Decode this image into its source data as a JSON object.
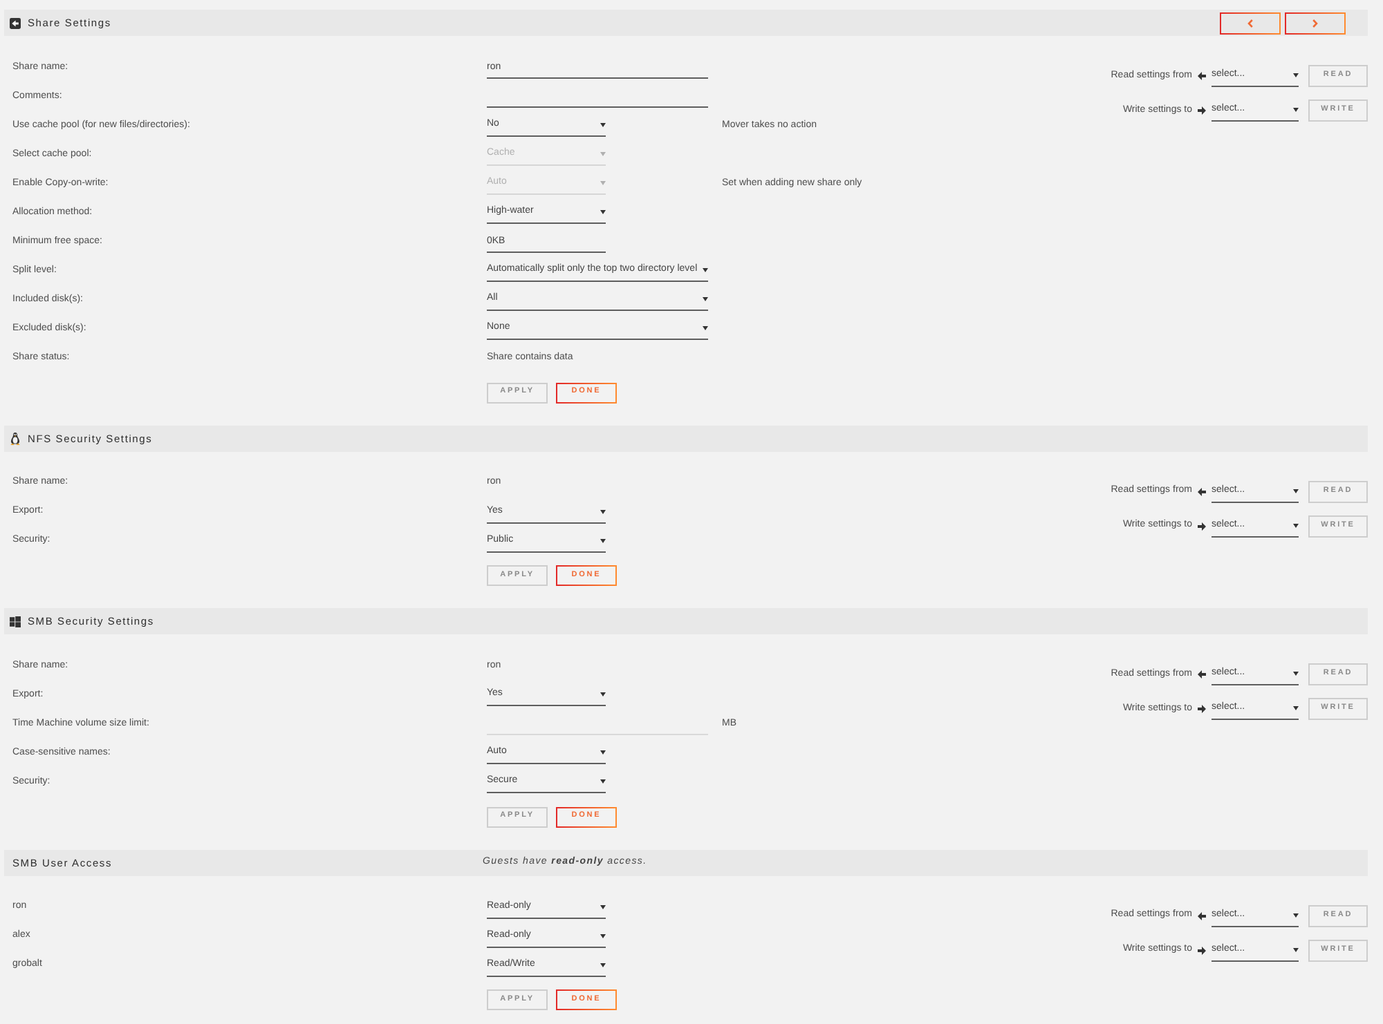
{
  "sections": [
    {
      "kind": "share",
      "title": "Share Settings",
      "nav_buttons": [
        {
          "kind": "previous",
          "disabled": false
        },
        {
          "kind": "next",
          "disabled": false
        }
      ],
      "rows": [
        {
          "label": "Share name:",
          "kind": "field",
          "value": "ron",
          "disabled": false
        },
        {
          "label": "Comments:",
          "kind": "field",
          "disabled": false
        },
        {
          "label": "Use cache pool (for new files/directories):",
          "kind": "select",
          "value": "No",
          "disabled": false,
          "note": "Mover takes no action"
        },
        {
          "label": "Select cache pool:",
          "kind": "select",
          "value": "Cache",
          "disabled": true
        },
        {
          "label": "Enable Copy-on-write:",
          "kind": "select",
          "value": "Auto",
          "disabled": true,
          "note": "Set when adding new share only"
        },
        {
          "label": "Allocation method:",
          "kind": "select",
          "value": "High-water",
          "disabled": false
        },
        {
          "label": "Minimum free space:",
          "kind": "short_field",
          "value": "0KB",
          "disabled": false
        },
        {
          "label": "Split level:",
          "kind": "wide_select",
          "value": "Automatically split only the top two directory level",
          "disabled": false
        },
        {
          "label": "Included disk(s):",
          "kind": "wide_select",
          "value": "All",
          "disabled": false
        },
        {
          "label": "Excluded disk(s):",
          "kind": "wide_select",
          "value": "None",
          "disabled": false
        },
        {
          "label": "Share status:",
          "kind": "value",
          "value": "Share contains data",
          "disabled": false
        }
      ],
      "actions": [
        {
          "label": "APPLY",
          "disabled": true
        },
        {
          "label": "DONE",
          "disabled": false
        }
      ],
      "transfer": [
        {
          "kind": "read",
          "label": "Read settings from",
          "value": "select...",
          "button": {
            "label": "READ",
            "disabled": true
          }
        },
        {
          "kind": "write",
          "label": "Write settings to",
          "value": "select...",
          "button": {
            "label": "WRITE",
            "disabled": true
          }
        }
      ]
    },
    {
      "kind": "nfs",
      "title": "NFS Security Settings",
      "rows": [
        {
          "label": "Share name:",
          "kind": "value",
          "value": "ron",
          "disabled": false
        },
        {
          "label": "Export:",
          "kind": "select",
          "value": "Yes",
          "disabled": false
        },
        {
          "label": "Security:",
          "kind": "select",
          "value": "Public",
          "disabled": false
        }
      ],
      "actions": [
        {
          "label": "APPLY",
          "disabled": true
        },
        {
          "label": "DONE",
          "disabled": false
        }
      ],
      "transfer": [
        {
          "kind": "read",
          "label": "Read settings from",
          "value": "select...",
          "button": {
            "label": "READ",
            "disabled": true
          }
        },
        {
          "kind": "write",
          "label": "Write settings to",
          "value": "select...",
          "button": {
            "label": "WRITE",
            "disabled": true
          }
        }
      ]
    },
    {
      "kind": "smb",
      "title": "SMB Security Settings",
      "rows": [
        {
          "label": "Share name:",
          "kind": "value",
          "value": "ron",
          "disabled": false
        },
        {
          "label": "Export:",
          "kind": "select",
          "value": "Yes",
          "disabled": false
        },
        {
          "label": "Time Machine volume size limit:",
          "kind": "field",
          "disabled": true,
          "note": "MB"
        },
        {
          "label": "Case-sensitive names:",
          "kind": "select",
          "value": "Auto",
          "disabled": false
        },
        {
          "label": "Security:",
          "kind": "select",
          "value": "Secure",
          "disabled": false
        }
      ],
      "actions": [
        {
          "label": "APPLY",
          "disabled": true
        },
        {
          "label": "DONE",
          "disabled": false
        }
      ],
      "transfer": [
        {
          "kind": "read",
          "label": "Read settings from",
          "value": "select...",
          "button": {
            "label": "READ",
            "disabled": true
          }
        },
        {
          "kind": "write",
          "label": "Write settings to",
          "value": "select...",
          "button": {
            "label": "WRITE",
            "disabled": true
          }
        }
      ]
    },
    {
      "kind": "users",
      "title": "SMB User Access",
      "header_note": "Guests have **read-only** access.",
      "rows": [
        {
          "label": "ron",
          "kind": "select",
          "value": "Read-only",
          "disabled": false
        },
        {
          "label": "alex",
          "kind": "select",
          "value": "Read-only",
          "disabled": false
        },
        {
          "label": "grobalt",
          "kind": "select",
          "value": "Read/Write",
          "disabled": false
        }
      ],
      "actions": [
        {
          "label": "APPLY",
          "disabled": true
        },
        {
          "label": "DONE",
          "disabled": false
        }
      ],
      "transfer": [
        {
          "kind": "read",
          "label": "Read settings from",
          "value": "select...",
          "button": {
            "label": "READ",
            "disabled": true
          }
        },
        {
          "kind": "write",
          "label": "Write settings to",
          "value": "select...",
          "button": {
            "label": "WRITE",
            "disabled": true
          }
        }
      ]
    }
  ]
}
